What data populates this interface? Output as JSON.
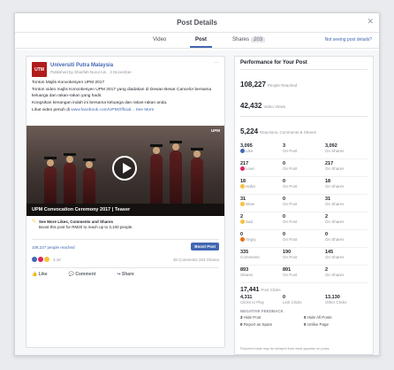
{
  "dialog": {
    "title": "Post Details",
    "close_glyph": "✕"
  },
  "tabs": [
    {
      "label": "Video"
    },
    {
      "label": "Post"
    },
    {
      "label": "Shares",
      "count": "203"
    }
  ],
  "report_link": "Not seeing post details?",
  "post": {
    "page_logo_text": "UTM",
    "page_name": "Universiti Putra Malaysia",
    "meta": "Published by Sharifah Nurul Ain · 3 December ·",
    "menu_glyph": "···",
    "paragraphs": [
      "Tonton Majlis Konvokesyen UPM 2017",
      "Tonton video majlis Konvokesyen UPM 2017 yang diadakan di Dewan Besar Cancelor bersama keluarga dan rakan-rakan yang hadir.",
      "Kongsikan kenangan indah ini bersama keluarga dan rakan-rakan anda."
    ],
    "link_prefix": "Lihat video penuh di ",
    "link_text": "www.facebook.com/UPMOfficial",
    "see_more": "... See More",
    "video_mark": "UPM",
    "video_caption": "UPM Convocation Ceremony 2017 | Teaser",
    "cta_title": "See More Likes, Comments and Shares",
    "cta_text": "Boost this post for RM20 to reach up to 3,100 people.",
    "people_reached": "108,227 people reached",
    "boost_label": "Boost Post",
    "reaction_count": "3.1K",
    "comments_shares": "48 Comments  203 Shares",
    "actions": [
      "Like",
      "Comment",
      "Share"
    ]
  },
  "performance": {
    "title": "Performance for Your Post",
    "stats": [
      {
        "value": "108,227",
        "label": "People Reached"
      },
      {
        "value": "42,432",
        "label": "Video Views"
      },
      {
        "value": "5,224",
        "label": "Reactions, Comments & Shares"
      }
    ],
    "grid": [
      [
        {
          "value": "3,095",
          "label": "Like",
          "color": "#4267b2"
        },
        {
          "value": "3",
          "label": "On Post"
        },
        {
          "value": "3,092",
          "label": "On Shares"
        }
      ],
      [
        {
          "value": "217",
          "label": "Love",
          "color": "#e0245e"
        },
        {
          "value": "0",
          "label": "On Post"
        },
        {
          "value": "217",
          "label": "On Shares"
        }
      ],
      [
        {
          "value": "18",
          "label": "Haha",
          "color": "#f5c33b"
        },
        {
          "value": "0",
          "label": "On Post"
        },
        {
          "value": "18",
          "label": "On Shares"
        }
      ],
      [
        {
          "value": "31",
          "label": "Wow",
          "color": "#f5c33b"
        },
        {
          "value": "0",
          "label": "On Post"
        },
        {
          "value": "31",
          "label": "On Shares"
        }
      ],
      [
        {
          "value": "2",
          "label": "Sad",
          "color": "#f5c33b"
        },
        {
          "value": "0",
          "label": "On Post"
        },
        {
          "value": "2",
          "label": "On Shares"
        }
      ],
      [
        {
          "value": "0",
          "label": "Angry",
          "color": "#e9710f"
        },
        {
          "value": "0",
          "label": "On Post"
        },
        {
          "value": "0",
          "label": "On Shares"
        }
      ],
      [
        {
          "value": "335",
          "label": "Comments"
        },
        {
          "value": "190",
          "label": "On Post"
        },
        {
          "value": "145",
          "label": "On Shares"
        }
      ],
      [
        {
          "value": "893",
          "label": "Shares"
        },
        {
          "value": "891",
          "label": "On Post"
        },
        {
          "value": "2",
          "label": "On Shares"
        }
      ]
    ],
    "clicks": {
      "value": "17,441",
      "label": "Post Clicks"
    },
    "clicks_grid": [
      {
        "value": "4,311",
        "label": "Clicks to Play"
      },
      {
        "value": "0",
        "label": "Link Clicks"
      },
      {
        "value": "13,130",
        "label": "Other Clicks"
      }
    ],
    "negative_title": "NEGATIVE FEEDBACK",
    "negative": [
      {
        "value": "3",
        "label": "Hide Post"
      },
      {
        "value": "0",
        "label": "Hide All Posts"
      },
      {
        "value": "0",
        "label": "Report as Spam"
      },
      {
        "value": "0",
        "label": "Unlike Page"
      }
    ],
    "footnote": "Reported stats may be delayed from what appears on posts"
  }
}
